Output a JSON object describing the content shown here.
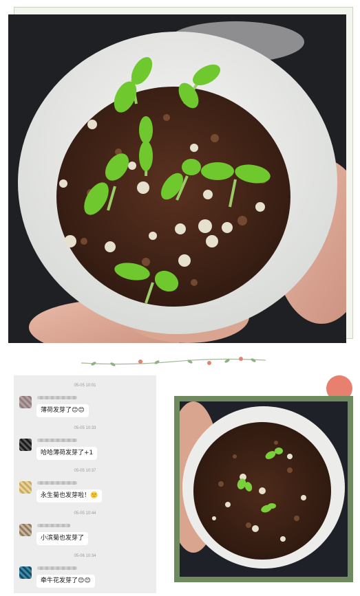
{
  "top_photo": {
    "icon": "seedling-cup-photo"
  },
  "divider": {
    "icon": "vine-divider-icon"
  },
  "chat": {
    "messages": [
      {
        "time": "05-05 10:01",
        "text": "薄荷发芽了😊😊"
      },
      {
        "time": "05-05 10:33",
        "text": "哈哈薄荷发芽了+1"
      },
      {
        "time": "05-05 10:37",
        "text": "永生菊也发芽啦！🙂"
      },
      {
        "time": "05-05 10:44",
        "text": "小滨菊也发芽了"
      },
      {
        "time": "05-06 10:34",
        "text": "牵牛花发芽了😊😊"
      }
    ]
  },
  "right_photo": {
    "icon": "sprouts-cup-photo"
  },
  "colors": {
    "frame_green": "#6e8a5e",
    "accent_coral": "#e8806f",
    "chat_bg": "#ededed",
    "leaf_green": "#7ccf3c"
  }
}
